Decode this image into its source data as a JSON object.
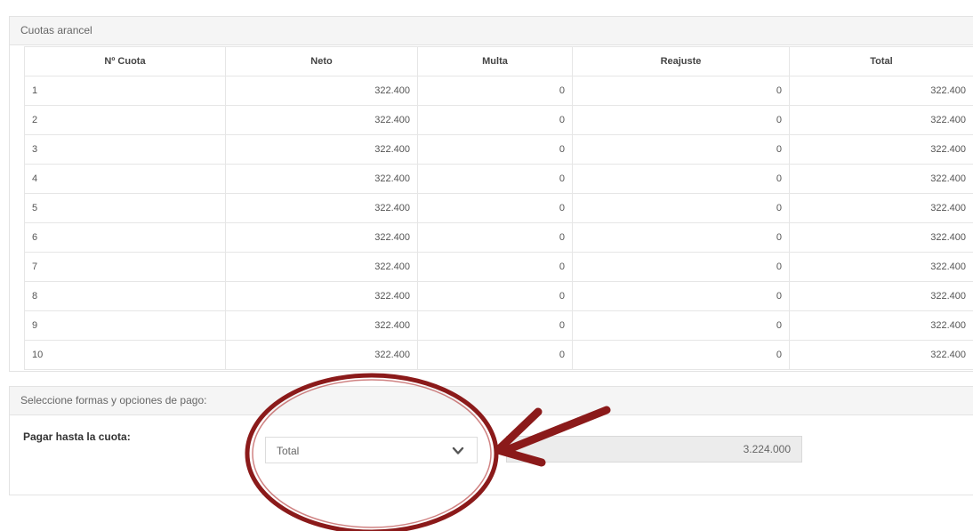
{
  "cuotas_panel": {
    "title": "Cuotas arancel",
    "columns": [
      "Nº Cuota",
      "Neto",
      "Multa",
      "Reajuste",
      "Total"
    ],
    "rows": [
      [
        "1",
        "322.400",
        "0",
        "0",
        "322.400"
      ],
      [
        "2",
        "322.400",
        "0",
        "0",
        "322.400"
      ],
      [
        "3",
        "322.400",
        "0",
        "0",
        "322.400"
      ],
      [
        "4",
        "322.400",
        "0",
        "0",
        "322.400"
      ],
      [
        "5",
        "322.400",
        "0",
        "0",
        "322.400"
      ],
      [
        "6",
        "322.400",
        "0",
        "0",
        "322.400"
      ],
      [
        "7",
        "322.400",
        "0",
        "0",
        "322.400"
      ],
      [
        "8",
        "322.400",
        "0",
        "0",
        "322.400"
      ],
      [
        "9",
        "322.400",
        "0",
        "0",
        "322.400"
      ],
      [
        "10",
        "322.400",
        "0",
        "0",
        "322.400"
      ]
    ]
  },
  "payment_panel": {
    "title": "Seleccione formas y opciones de pago:",
    "label": "Pagar hasta la cuota:",
    "select_value": "Total",
    "select_icon": "chevron-down-icon",
    "total_amount": "3.224.000"
  },
  "annotation": {
    "color": "#8b1a1a",
    "shapes": [
      "ellipse-highlight",
      "arrow-pointer"
    ]
  }
}
